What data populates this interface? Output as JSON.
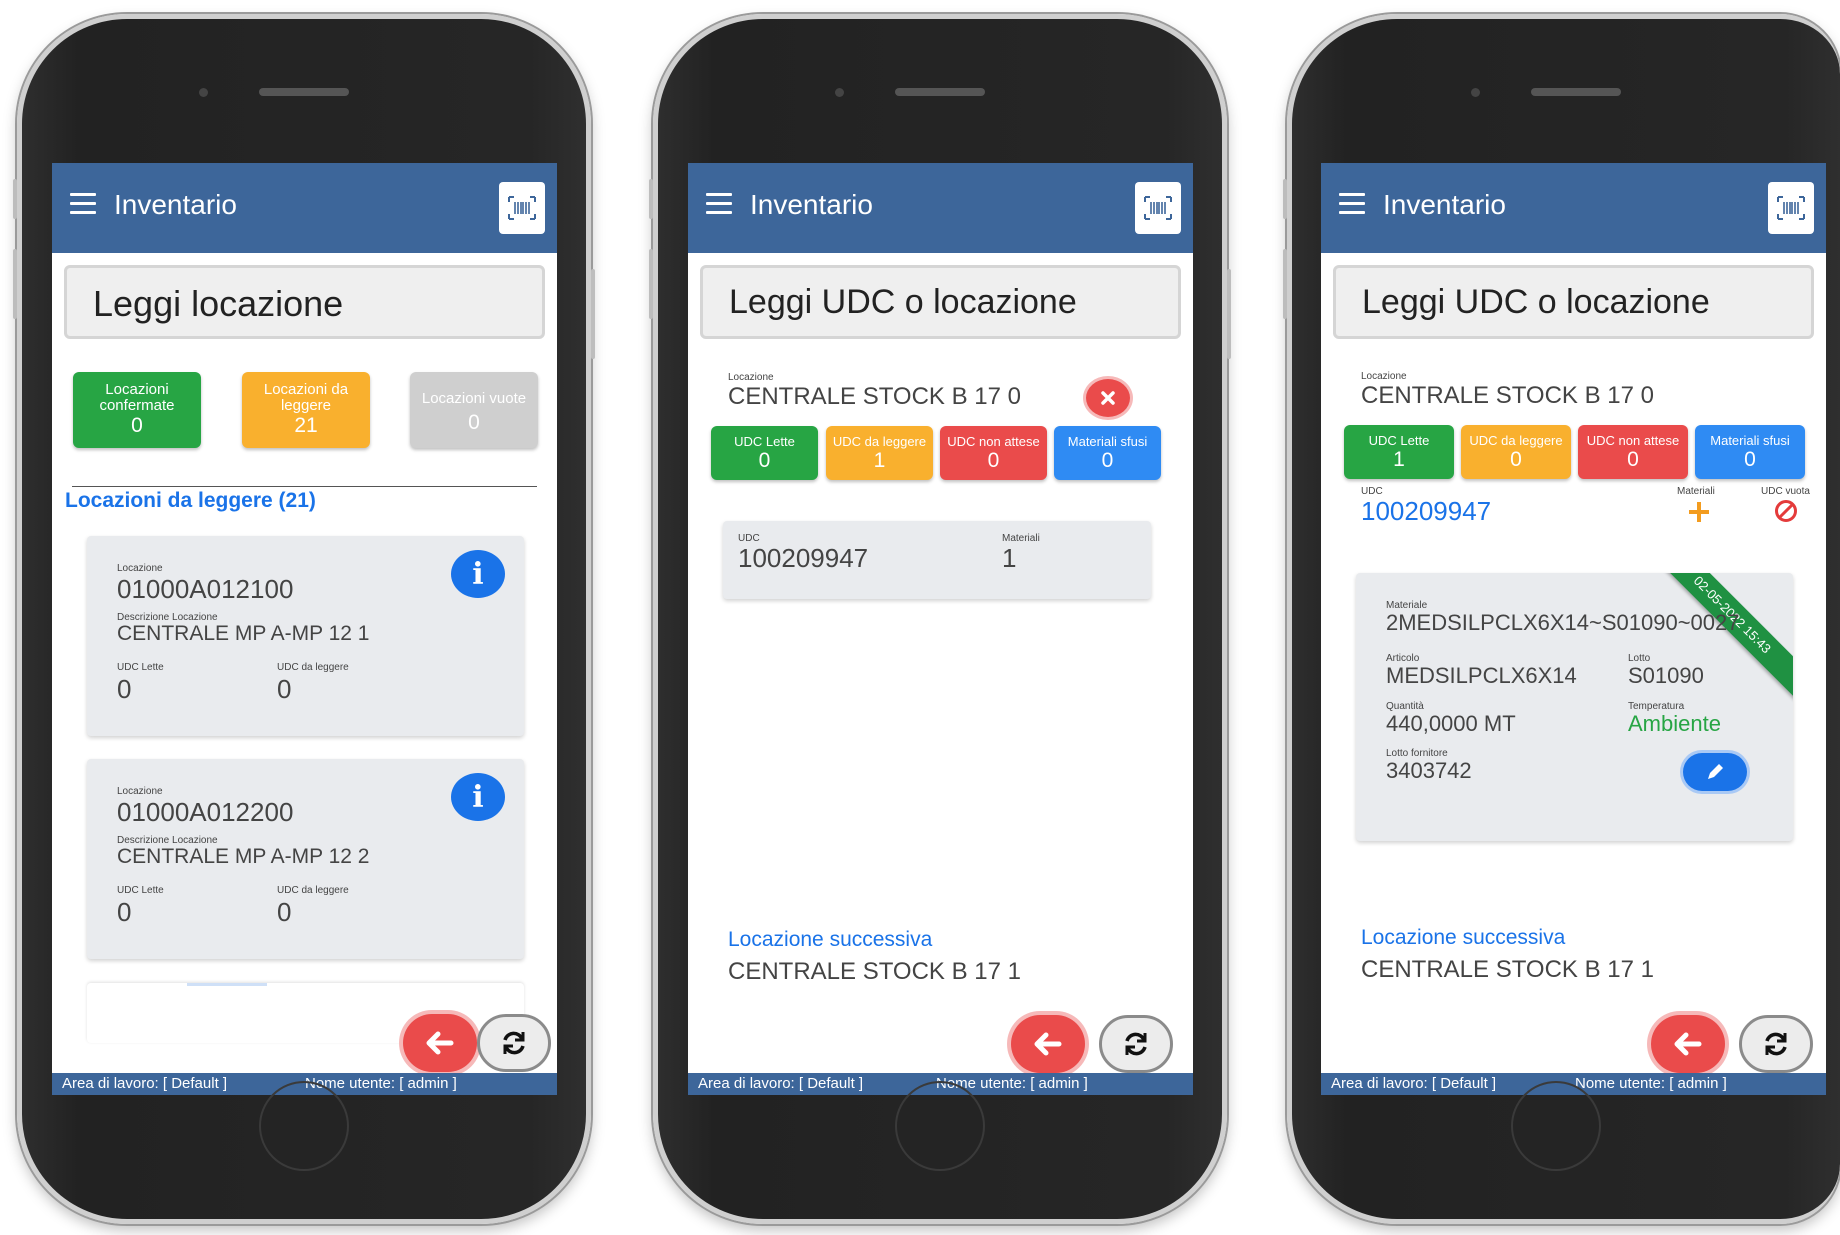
{
  "common": {
    "app_title": "Inventario",
    "footer_workspace": "Area di lavoro: [ Default ]",
    "footer_user": "Nome utente: [ admin ]",
    "icons": {
      "menu": "hamburger-icon",
      "scan": "barcode-scan-icon",
      "back": "arrow-left-icon",
      "refresh": "refresh-icon"
    },
    "colors": {
      "header": "#3d669a",
      "green": "#27a544",
      "orange": "#f9b02e",
      "red": "#ea4b4b",
      "blue": "#2f8bf3",
      "grey": "#cfcfcf"
    }
  },
  "phone1": {
    "prompt": "Leggi locazione",
    "tiles": [
      {
        "label": "Locazioni confermate",
        "value": "0"
      },
      {
        "label": "Locazioni da leggere",
        "value": "21"
      },
      {
        "label": "Locazioni vuote",
        "value": "0"
      }
    ],
    "list_title": "Locazioni da leggere (21)",
    "labels": {
      "location": "Locazione",
      "description": "Descrizione Locazione",
      "read": "UDC Lette",
      "to_read": "UDC da leggere"
    },
    "cards": [
      {
        "location": "01000A012100",
        "description": "CENTRALE MP A-MP 12 1",
        "read": "0",
        "to_read": "0"
      },
      {
        "location": "01000A012200",
        "description": "CENTRALE MP A-MP 12 2",
        "read": "0",
        "to_read": "0"
      }
    ]
  },
  "phone2": {
    "prompt": "Leggi UDC o locazione",
    "location_label": "Locazione",
    "location": "CENTRALE STOCK B 17 0",
    "tiles": [
      {
        "label": "UDC Lette",
        "value": "0"
      },
      {
        "label": "UDC da leggere",
        "value": "1"
      },
      {
        "label": "UDC non attese",
        "value": "0"
      },
      {
        "label": "Materiali sfusi",
        "value": "0"
      }
    ],
    "udc_card": {
      "udc_label": "UDC",
      "udc": "100209947",
      "materials_label": "Materiali",
      "materials": "1"
    },
    "next_label": "Locazione successiva",
    "next_location": "CENTRALE STOCK B 17 1"
  },
  "phone3": {
    "prompt": "Leggi UDC o locazione",
    "location_label": "Locazione",
    "location": "CENTRALE STOCK B 17 0",
    "tiles": [
      {
        "label": "UDC Lette",
        "value": "1"
      },
      {
        "label": "UDC da leggere",
        "value": "0"
      },
      {
        "label": "UDC non attese",
        "value": "0"
      },
      {
        "label": "Materiali sfusi",
        "value": "0"
      }
    ],
    "udc_label": "UDC",
    "udc": "100209947",
    "materials_label": "Materiali",
    "empty_label": "UDC vuota",
    "material_card": {
      "ribbon": "02-05-2022 15:43",
      "material_label": "Materiale",
      "material": "2MEDSILPCLX6X14~S01090~0027",
      "article_label": "Articolo",
      "article": "MEDSILPCLX6X14",
      "lot_label": "Lotto",
      "lot": "S01090",
      "qty_label": "Quantità",
      "qty": "440,0000 MT",
      "temp_label": "Temperatura",
      "temp": "Ambiente",
      "supplier_lot_label": "Lotto fornitore",
      "supplier_lot": "3403742"
    },
    "next_label": "Locazione successiva",
    "next_location": "CENTRALE STOCK B 17 1"
  }
}
